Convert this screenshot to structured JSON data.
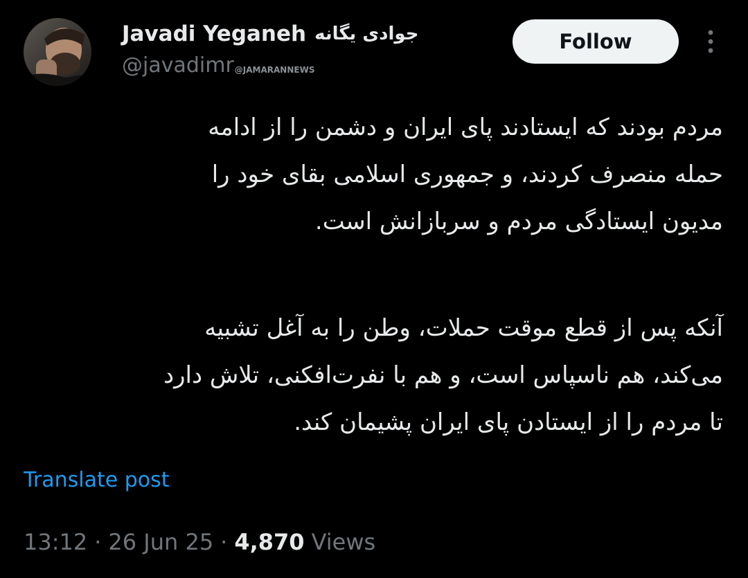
{
  "author": {
    "display_name": "Javadi Yeganeh",
    "display_name_fa": "جوادی یگانه",
    "handle": "@javadimr",
    "watermark": "@JAMARANNEWS",
    "avatar_icon": "profile-photo"
  },
  "actions": {
    "follow_label": "Follow",
    "more_icon": "vertical-ellipsis-icon"
  },
  "tweet": {
    "paragraph_1": [
      "مردم بودند که ایستادند پای ایران و دشمن را از ادامه",
      "حمله منصرف کردند، و جمهوری اسلامی بقای خود را",
      "مدیون ایستادگی مردم و سربازانش است."
    ],
    "paragraph_2": [
      "آنکه پس از قطع موقت حملات، وطن را به آغل تشبیه",
      "می‌کند، هم ناسپاس است، و هم با نفرت‌افکنی، تلاش دارد",
      "تا مردم را از ایستادن پای ایران پشیمان کند."
    ],
    "translate_label": "Translate post"
  },
  "meta": {
    "time": "13:12",
    "separator": "·",
    "date": "26 Jun 25",
    "views_count": "4,870",
    "views_label": "Views"
  },
  "colors": {
    "background": "#000000",
    "primary_text": "#e7e9ea",
    "secondary_text": "#71767b",
    "link": "#1d9bf0",
    "follow_button_bg": "#eff3f4"
  }
}
